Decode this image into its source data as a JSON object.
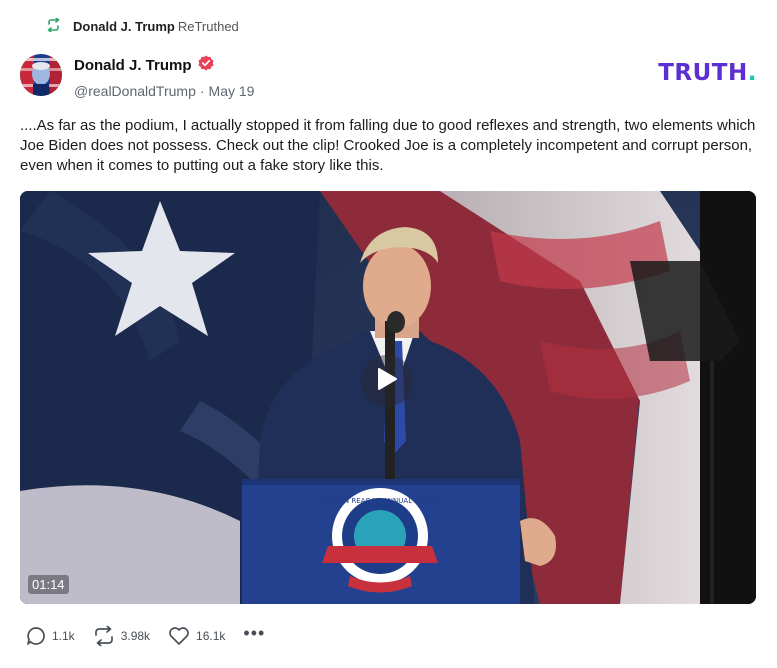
{
  "retruth": {
    "name": "Donald J. Trump",
    "verb": "ReTruthed",
    "icon": "retruth-icon",
    "icon_color": "#2fa56a"
  },
  "post": {
    "author_name": "Donald J. Trump",
    "verified_icon": "verified-badge-icon",
    "verified_color": "#e8425a",
    "handle": "@realDonaldTrump",
    "separator": "·",
    "date": "May 19",
    "text": "....As far as the podium, I actually stopped it from falling due to good reflexes and strength, two elements which Joe Biden does not possess. Check out the clip! Crooked Joe is a completely incompetent and corrupt person, even when it comes to putting out a fake story like this."
  },
  "brand": {
    "logo_text": "TRUTH",
    "logo_dot": ".",
    "color": "#5b2fd1",
    "dot_color": "#1bc9a8"
  },
  "video": {
    "duration": "01:14",
    "play_icon": "play-icon",
    "podium_sign_text": "LINCOLN REAGAN ANNUAL DINNER"
  },
  "actions": {
    "replies": "1.1k",
    "retruths": "3.98k",
    "likes": "16.1k",
    "more": "•••"
  }
}
